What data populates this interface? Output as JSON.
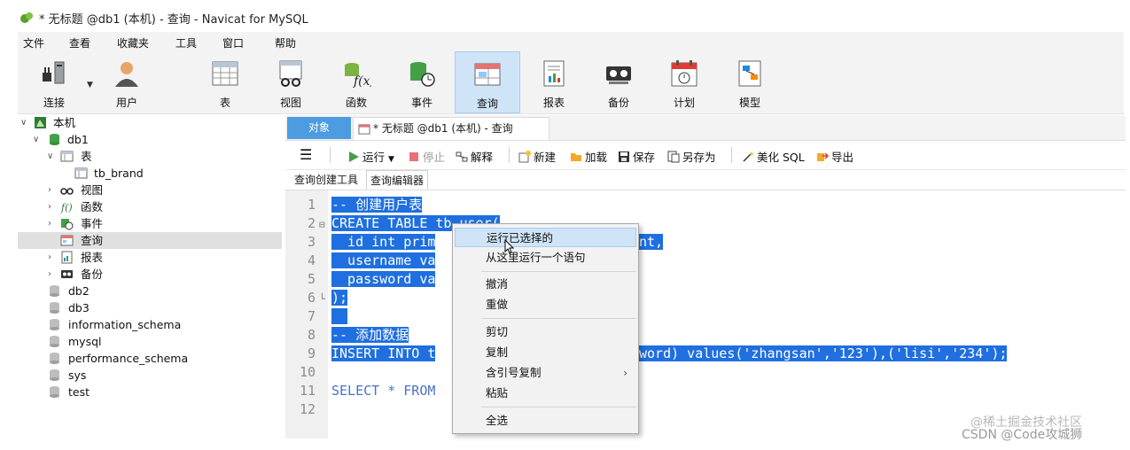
{
  "window": {
    "title": "* 无标题 @db1 (本机) - 查询 - Navicat for MySQL"
  },
  "menubar": [
    "文件",
    "查看",
    "收藏夹",
    "工具",
    "窗口",
    "帮助"
  ],
  "toolbar": [
    {
      "label": "连接",
      "icon": "connection-icon"
    },
    {
      "label": "用户",
      "icon": "user-icon"
    },
    {
      "label": "表",
      "icon": "table-icon"
    },
    {
      "label": "视图",
      "icon": "view-icon"
    },
    {
      "label": "函数",
      "icon": "function-icon"
    },
    {
      "label": "事件",
      "icon": "event-icon"
    },
    {
      "label": "查询",
      "icon": "query-icon",
      "active": true
    },
    {
      "label": "报表",
      "icon": "report-icon"
    },
    {
      "label": "备份",
      "icon": "backup-icon"
    },
    {
      "label": "计划",
      "icon": "schedule-icon"
    },
    {
      "label": "模型",
      "icon": "model-icon"
    }
  ],
  "tree": {
    "connection": "本机",
    "database": "db1",
    "groups": {
      "tables": "表",
      "table_item": "tb_brand",
      "views": "视图",
      "functions": "函数",
      "events": "事件",
      "queries": "查询",
      "reports": "报表",
      "backups": "备份"
    },
    "other_databases": [
      "db2",
      "db3",
      "information_schema",
      "mysql",
      "performance_schema",
      "sys",
      "test"
    ]
  },
  "tabs": {
    "objects": "对象",
    "query_tab": "* 无标题 @db1 (本机) - 查询"
  },
  "query_toolbar": {
    "run": "运行",
    "stop": "停止",
    "explain": "解释",
    "new": "新建",
    "load": "加载",
    "save": "保存",
    "save_as": "另存为",
    "beautify": "美化 SQL",
    "export": "导出"
  },
  "subtabs": {
    "builder": "查询创建工具",
    "editor": "查询编辑器"
  },
  "editor": {
    "line_numbers": [
      "1",
      "2",
      "3",
      "4",
      "5",
      "6",
      "7",
      "8",
      "9",
      "10",
      "11",
      "12"
    ],
    "lines": [
      {
        "text": "-- 创建用户表",
        "selected": true
      },
      {
        "text": "CREATE TABLE tb_user(",
        "selected": true
      },
      {
        "text": "  id int prim",
        "tail": "nt,",
        "selected": true
      },
      {
        "text": "  username va",
        "selected": true
      },
      {
        "text": "  password va",
        "selected": true
      },
      {
        "text": ");",
        "selected": true
      },
      {
        "text": "",
        "selected": true
      },
      {
        "text": "-- 添加数据",
        "selected": true
      },
      {
        "text": "INSERT INTO t",
        "tail": "word) values('zhangsan','123'),('lisi','234');",
        "selected": true
      },
      {
        "text": "",
        "selected": false
      },
      {
        "text": "SELECT * FROM",
        "selected": false
      },
      {
        "text": "",
        "selected": false
      }
    ]
  },
  "context_menu": {
    "items": [
      "运行已选择的",
      "从这里运行一个语句",
      "撤消",
      "重做",
      "剪切",
      "复制",
      "含引号复制",
      "粘贴",
      "全选"
    ],
    "submenu_arrow": "›"
  },
  "watermark": {
    "line1": "@稀土掘金技术社区",
    "line2": "CSDN @Code攻城狮"
  },
  "colors": {
    "selection": "#1f6fe0",
    "active_tab": "#4d9be0",
    "hover": "#cfe4f7"
  }
}
